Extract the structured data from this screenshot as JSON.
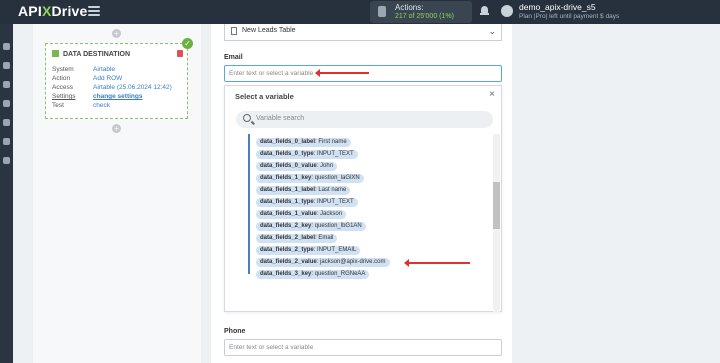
{
  "app": {
    "logo_left": "API",
    "logo_x": "X",
    "logo_right": "Drive"
  },
  "header": {
    "actions_label": "Actions:",
    "actions_value": "217 of 25'000 (1%)",
    "user_name": "demo_apix-drive_s5",
    "user_plan": "Plan |Pro| left until payment $ days"
  },
  "destination": {
    "title": "DATA DESTINATION",
    "rows": [
      {
        "k": "System",
        "v": "Airtable"
      },
      {
        "k": "Action",
        "v": "Add ROW"
      },
      {
        "k": "Access",
        "v": "Airtable (25.06.2024 12:42)"
      },
      {
        "k": "Settings",
        "v": "change settings"
      },
      {
        "k": "Test",
        "v": "check"
      }
    ]
  },
  "form": {
    "table_value": "New Leads Table",
    "email_label": "Email",
    "email_placeholder": "Enter text or select a variable",
    "phone_label": "Phone",
    "phone_placeholder": "Enter text or select a variable"
  },
  "popup": {
    "title": "Select a variable",
    "close": "×",
    "search_placeholder": "Variable search",
    "variables": [
      {
        "key": "data_fields_0_label",
        "val": "First name"
      },
      {
        "key": "data_fields_0_type",
        "val": "INPUT_TEXT"
      },
      {
        "key": "data_fields_0_value",
        "val": "John"
      },
      {
        "key": "data_fields_1_key",
        "val": "question_laGlXN"
      },
      {
        "key": "data_fields_1_label",
        "val": "Last name"
      },
      {
        "key": "data_fields_1_type",
        "val": "INPUT_TEXT"
      },
      {
        "key": "data_fields_1_value",
        "val": "Jackson"
      },
      {
        "key": "data_fields_2_key",
        "val": "question_lbG1AN"
      },
      {
        "key": "data_fields_2_label",
        "val": "Email"
      },
      {
        "key": "data_fields_2_type",
        "val": "INPUT_EMAIL"
      },
      {
        "key": "data_fields_2_value",
        "val": "jackson@apix-drive.com"
      },
      {
        "key": "data_fields_3_key",
        "val": "question_RGNeAA"
      }
    ]
  },
  "colors": {
    "topbar": "#27313d",
    "accent_green": "#8fd35c",
    "link_blue": "#3b7dc4",
    "arrow_red": "#e03131",
    "chip_blue": "#cfe1f3"
  }
}
